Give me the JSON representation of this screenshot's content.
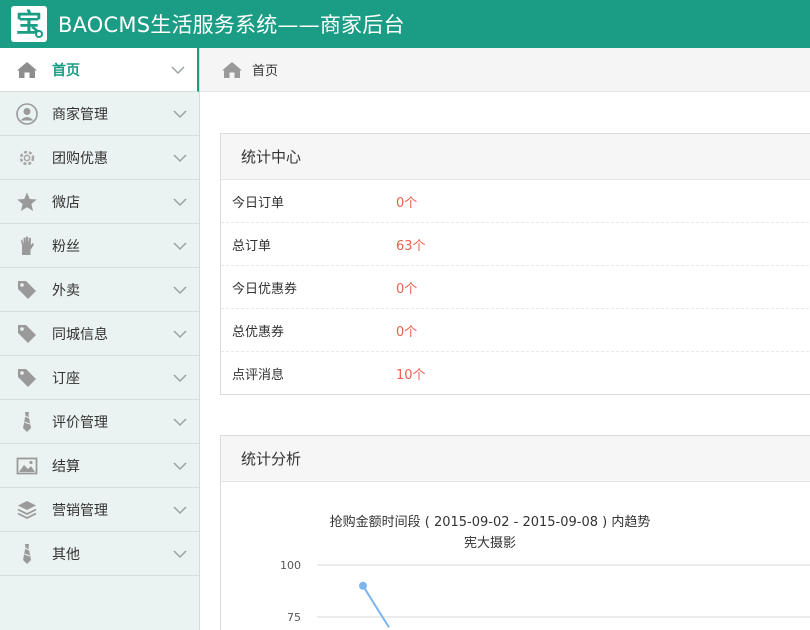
{
  "header": {
    "logo_char": "宝",
    "title": "BAOCMS生活服务系统——商家后台"
  },
  "sidebar": {
    "items": [
      {
        "label": "首页",
        "icon": "home-icon",
        "active": true
      },
      {
        "label": "商家管理",
        "icon": "user-icon"
      },
      {
        "label": "团购优惠",
        "icon": "gear-icon"
      },
      {
        "label": "微店",
        "icon": "star-icon"
      },
      {
        "label": "粉丝",
        "icon": "hand-icon"
      },
      {
        "label": "外卖",
        "icon": "tag-icon"
      },
      {
        "label": "同城信息",
        "icon": "tag-icon"
      },
      {
        "label": "订座",
        "icon": "tag-icon"
      },
      {
        "label": "评价管理",
        "icon": "tie-icon"
      },
      {
        "label": "结算",
        "icon": "picture-icon"
      },
      {
        "label": "营销管理",
        "icon": "layers-icon"
      },
      {
        "label": "其他",
        "icon": "tie-icon"
      }
    ]
  },
  "breadcrumb": {
    "label": "首页",
    "icon": "home-icon"
  },
  "stats": {
    "title": "统计中心",
    "rows": [
      {
        "label": "今日订单",
        "value": "0个"
      },
      {
        "label": "总订单",
        "value": "63个"
      },
      {
        "label": "今日优惠券",
        "value": "0个"
      },
      {
        "label": "总优惠券",
        "value": "0个"
      },
      {
        "label": "点评消息",
        "value": "10个"
      }
    ]
  },
  "analysis": {
    "title": "统计分析",
    "chart_title_line1": "抢购金额时间段 ( 2015-09-02 - 2015-09-08 ) 内趋势",
    "chart_title_line2": "宪大摄影"
  },
  "chart_data": {
    "type": "line",
    "title": "抢购金额时间段 ( 2015-09-02 - 2015-09-08 ) 内趋势",
    "subtitle": "宪大摄影",
    "y_ticks": [
      100,
      75
    ],
    "series": [
      {
        "values": [
          90,
          70
        ]
      }
    ],
    "color": "#7cb5ec"
  },
  "colors": {
    "accent": "#1b9c85",
    "value": "#e8604c"
  }
}
